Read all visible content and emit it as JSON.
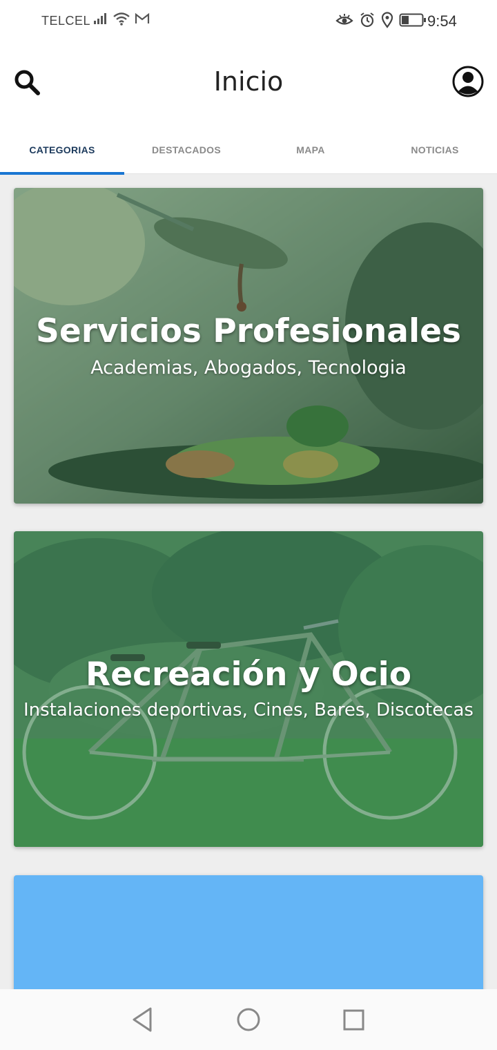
{
  "status_bar": {
    "carrier": "TELCEL",
    "time": "9:54",
    "icons": [
      "signal-icon",
      "wifi-icon",
      "gmail-icon",
      "eye-icon",
      "alarm-icon",
      "location-icon",
      "battery-icon"
    ]
  },
  "app_bar": {
    "title": "Inicio",
    "icons": [
      "search-icon",
      "account-icon"
    ]
  },
  "tabs": [
    {
      "label": "CATEGORIAS",
      "active": true
    },
    {
      "label": "DESTACADOS",
      "active": false
    },
    {
      "label": "MAPA",
      "active": false
    },
    {
      "label": "NOTICIAS",
      "active": false
    }
  ],
  "categories": [
    {
      "title": "Servicios Profesionales",
      "subtitle": "Academias, Abogados, Tecnologia"
    },
    {
      "title": "Recreación y Ocio",
      "subtitle": "Instalaciones deportivas, Cines, Bares, Discotecas"
    }
  ],
  "colors": {
    "accent": "#1976d2",
    "active_tab_text": "#1c3a5c",
    "card_overlay": "#2e7d46",
    "third_card": "#64b5f6"
  },
  "nav_bar": {
    "icons": [
      "back-icon",
      "home-icon",
      "recent-apps-icon"
    ]
  }
}
